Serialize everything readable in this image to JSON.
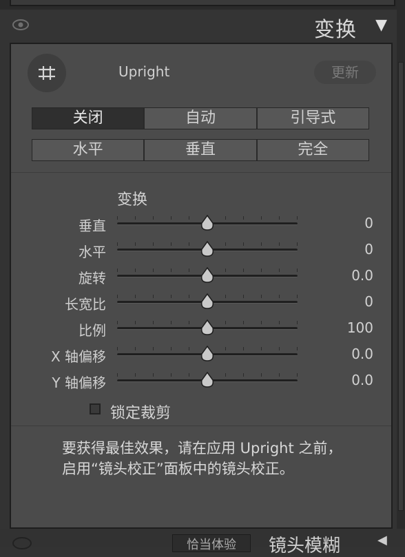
{
  "header": {
    "title": "变换",
    "collapse_icon": "triangle-down-icon"
  },
  "upright": {
    "label": "Upright",
    "update_button": "更新",
    "modes_row1": [
      "关闭",
      "自动",
      "引导式"
    ],
    "modes_row2": [
      "水平",
      "垂直",
      "完全"
    ],
    "active_mode": "关闭"
  },
  "transform": {
    "title": "变换",
    "sliders": [
      {
        "label": "垂直",
        "value": "0"
      },
      {
        "label": "水平",
        "value": "0"
      },
      {
        "label": "旋转",
        "value": "0.0"
      },
      {
        "label": "长宽比",
        "value": "0"
      },
      {
        "label": "比例",
        "value": "100"
      },
      {
        "label": "X 轴偏移",
        "value": "0.0"
      },
      {
        "label": "Y 轴偏移",
        "value": "0.0"
      }
    ]
  },
  "lock_crop": {
    "label": "锁定裁剪",
    "checked": false
  },
  "note": {
    "line1": "要获得最佳效果，请在应用 Upright 之前，",
    "line2": "启用“镜头校正”面板中的镜头校正。"
  },
  "next_section": {
    "button": "恰当体验",
    "title": "镜头模糊"
  }
}
